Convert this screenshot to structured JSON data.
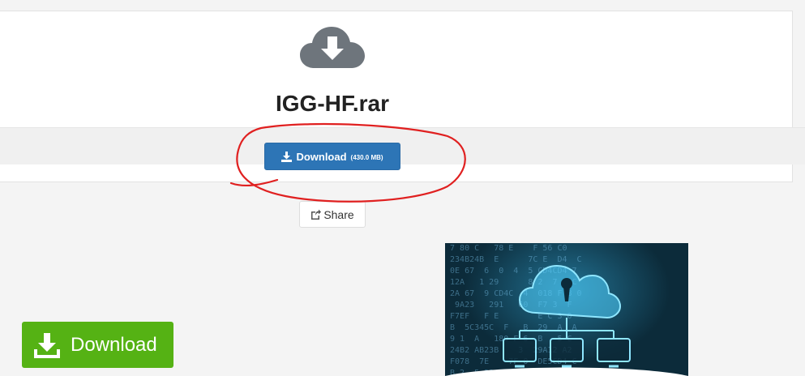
{
  "file": {
    "name": "IGG-HF.rar",
    "download_label": "Download",
    "download_size": "(430.0 MB)"
  },
  "share": {
    "label": "Share"
  },
  "ad": {
    "download_label": "Download"
  },
  "icons": {
    "cloud": "cloud-download-icon",
    "download": "download-icon",
    "share": "share-icon"
  },
  "colors": {
    "primary": "#2d75b6",
    "green": "#55b214",
    "cloud": "#6e757c",
    "annotation": "#e02020"
  }
}
